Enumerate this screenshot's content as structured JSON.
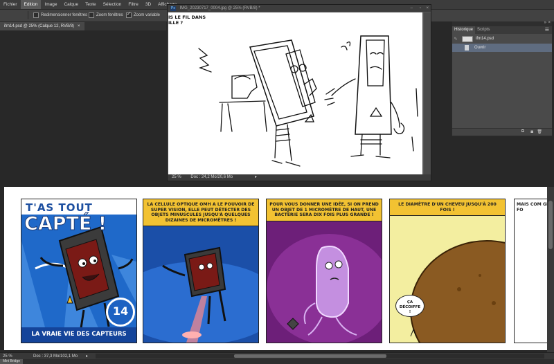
{
  "menu": [
    "Fichier",
    "Edition",
    "Image",
    "Calque",
    "Texte",
    "Sélection",
    "Filtre",
    "3D",
    "Affichage"
  ],
  "menu_active_index": 1,
  "options": {
    "resize_windows": "Redimensionner fenêtres",
    "zoom_windows": "Zoom fenêtres",
    "zoom_variable": "Zoom variable",
    "zoom_variable_checked": true
  },
  "doc_tab": {
    "title": "ifm14.psd @ 25% (Calque 12, RVB/8)",
    "close": "×"
  },
  "float_window": {
    "title": "IMG_20230717_0004.jpg @ 25% (RVB/8) *",
    "app_badge": "Ps",
    "zoom": "25 %",
    "doc_size": "Doc : 24,2 Mo/20,6 Mo",
    "sketch_text": "IS LE FIL DANS\nILLE ?"
  },
  "panel": {
    "tabs": [
      "Historique",
      "Scripts"
    ],
    "snapshot_label": "ifm14.psd",
    "history_item": "Ouvrir"
  },
  "comic": {
    "cover_title_1": "T'AS TOUT",
    "cover_title_2": "CAPTÉ !",
    "cover_number": "14",
    "cover_footer": "LA VRAIE VIE DES CAPTEURS",
    "p2_caption": "La cellule optique OMH a le pouvoir de super vision, elle peut détecter des objets minuscules jusqu'à quelques dizaines de micromètres !",
    "p3_caption": "Pour vous donner une idée, si on prend un objet de 1 micromètre de haut, une bactérie sera dix fois plus grande !",
    "p4_caption": "Le diamètre d'un cheveu jusqu'à 200 fois !",
    "p4_bubble": "ÇA DÉCOIFFE !",
    "p5_caption": "Mais com grand fo"
  },
  "status": {
    "zoom": "25 %",
    "doc_size": "Doc : 37,3 Mo/102,1 Mo"
  },
  "mini_tab": "Mini Bridge",
  "colors": {
    "yellow": "#f2c232",
    "blue": "#1f68c6",
    "purple": "#7a2a86"
  }
}
